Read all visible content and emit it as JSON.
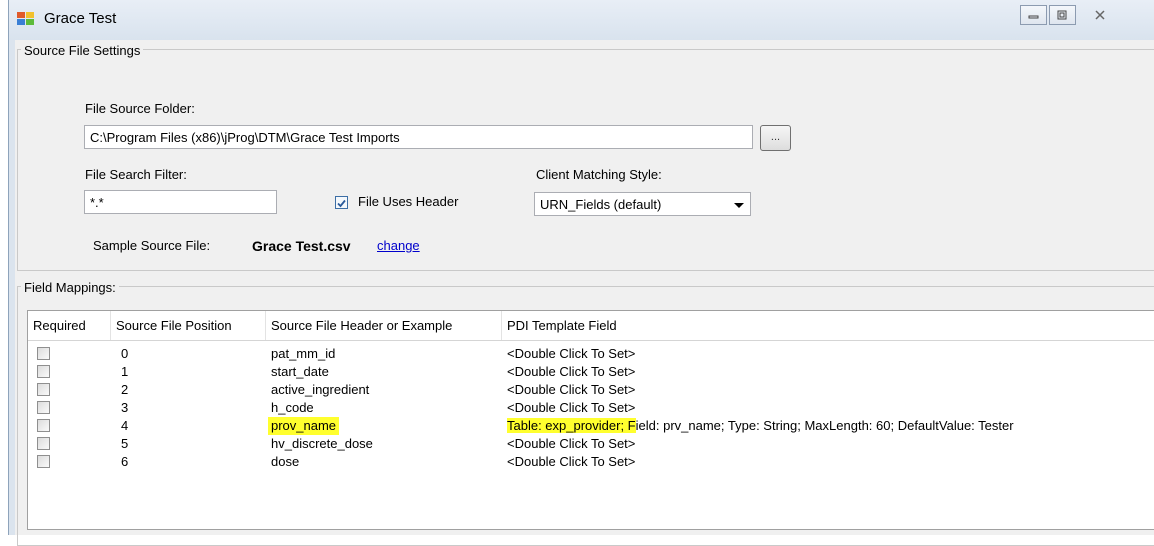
{
  "window": {
    "title": "Grace Test"
  },
  "source_settings": {
    "legend": "Source File Settings",
    "folder_label": "File Source Folder:",
    "folder_value": "C:\\Program Files (x86)\\jProg\\DTM\\Grace Test Imports",
    "browse_label": "...",
    "filter_label": "File Search Filter:",
    "filter_value": "*.*",
    "header_checkbox_label": "File Uses Header",
    "header_checked": true,
    "matching_label": "Client Matching Style:",
    "matching_value": "URN_Fields (default)",
    "sample_label": "Sample Source File:",
    "sample_file": "Grace Test.csv",
    "change_link": "change"
  },
  "field_mappings": {
    "legend": "Field Mappings:",
    "columns": [
      "Required",
      "Source File Position",
      "Source File Header or Example",
      "PDI Template Field"
    ],
    "rows": [
      {
        "required": false,
        "position": "0",
        "header": "pat_mm_id",
        "field": "<Double Click To Set>",
        "highlight": false
      },
      {
        "required": false,
        "position": "1",
        "header": "start_date",
        "field": "<Double Click To Set>",
        "highlight": false
      },
      {
        "required": false,
        "position": "2",
        "header": "active_ingredient",
        "field": "<Double Click To Set>",
        "highlight": false
      },
      {
        "required": false,
        "position": "3",
        "header": "h_code",
        "field": "<Double Click To Set>",
        "highlight": false
      },
      {
        "required": false,
        "position": "4",
        "header": "prov_name",
        "field_highlighted": "Table: exp_provider; F",
        "field": "ield: prv_name; Type: String; MaxLength: 60; DefaultValue: Tester",
        "highlight": true
      },
      {
        "required": false,
        "position": "5",
        "header": "hv_discrete_dose",
        "field": "<Double Click To Set>",
        "highlight": false
      },
      {
        "required": false,
        "position": "6",
        "header": "dose",
        "field": "<Double Click To Set>",
        "highlight": false
      }
    ]
  },
  "colors": {
    "highlight": "#ffff2e",
    "link": "#0000cc"
  }
}
